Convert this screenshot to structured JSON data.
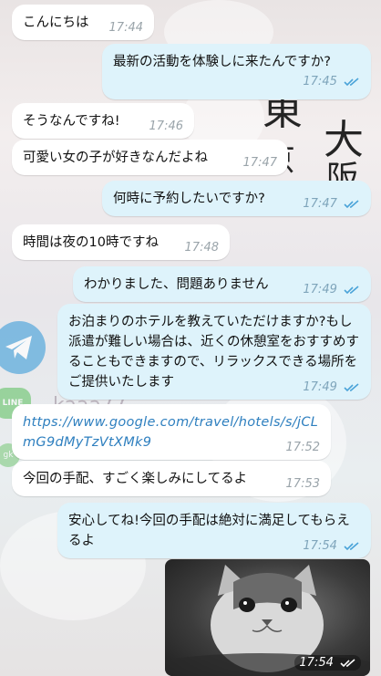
{
  "background": {
    "kanji_1": "東",
    "kanji_2": "京",
    "kanji_3": "大",
    "kanji_4": "阪",
    "contact_id": "kaaa77"
  },
  "colors": {
    "incoming_bubble": "#ffffff",
    "outgoing_bubble": "#def3fb",
    "timestamp": "#9aa4aa",
    "link": "#2e7fbf",
    "read_check": "#4aa3d8"
  },
  "messages": [
    {
      "direction": "in",
      "text": "こんにちは",
      "time": "17:44"
    },
    {
      "direction": "out",
      "text": "最新の活動を体験しに来たんですか?",
      "time": "17:45",
      "read": true
    },
    {
      "direction": "in",
      "text": "そうなんですね!",
      "time": "17:46"
    },
    {
      "direction": "in",
      "text": "可愛い女の子が好きなんだよね",
      "time": "17:47"
    },
    {
      "direction": "out",
      "text": "何時に予約したいですか?",
      "time": "17:47",
      "read": true
    },
    {
      "direction": "in",
      "text": "時間は夜の10時ですね",
      "time": "17:48"
    },
    {
      "direction": "out",
      "text": "わかりました、問題ありません",
      "time": "17:49",
      "read": true
    },
    {
      "direction": "out",
      "text": "お泊まりのホテルを教えていただけますか?もし派遣が難しい場合は、近くの休憩室をおすすめすることもできますので、リラックスできる場所をご提供いたします",
      "time": "17:49",
      "read": true
    },
    {
      "direction": "in",
      "text": "https://www.google.com/travel/hotels/s/jCLmG9dMyTzVtXMk9",
      "time": "17:52",
      "is_link": true
    },
    {
      "direction": "in",
      "text": "今回の手配、すごく楽しみにしてるよ",
      "time": "17:53"
    },
    {
      "direction": "out",
      "text": "安心してね!今回の手配は絶対に満足してもらえるよ",
      "time": "17:54",
      "read": true
    },
    {
      "direction": "out",
      "media": "cat-photo",
      "time": "17:54",
      "read": true
    }
  ]
}
